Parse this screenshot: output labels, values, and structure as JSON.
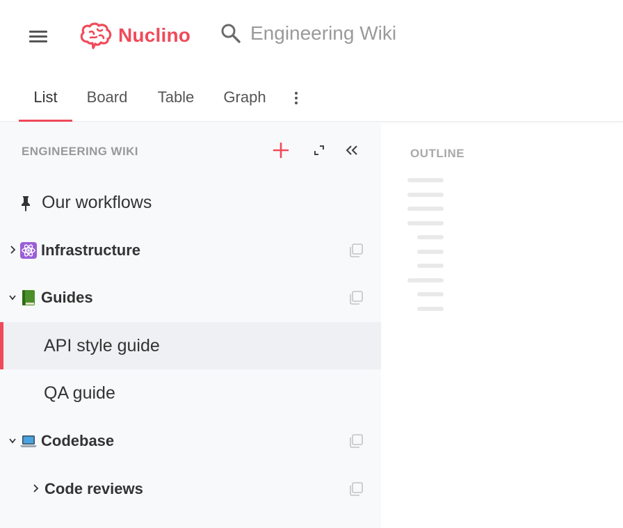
{
  "header": {
    "app_name": "Nuclino",
    "search_text": "Engineering Wiki",
    "brand_color": "#ef4a5a"
  },
  "tabs": [
    {
      "label": "List",
      "active": true
    },
    {
      "label": "Board",
      "active": false
    },
    {
      "label": "Table",
      "active": false
    },
    {
      "label": "Graph",
      "active": false
    }
  ],
  "sidebar": {
    "title": "ENGINEERING WIKI",
    "items": [
      {
        "label": "Our workflows",
        "icon": "pin-icon",
        "pinned": true
      },
      {
        "label": "Infrastructure",
        "emoji": "atom",
        "expanded": false
      },
      {
        "label": "Guides",
        "emoji": "green-book",
        "expanded": true
      },
      {
        "label": "API style guide",
        "selected": true
      },
      {
        "label": "QA guide"
      },
      {
        "label": "Codebase",
        "emoji": "laptop",
        "expanded": true
      },
      {
        "label": "Code reviews",
        "expanded": false
      }
    ]
  },
  "outline": {
    "title": "OUTLINE"
  }
}
